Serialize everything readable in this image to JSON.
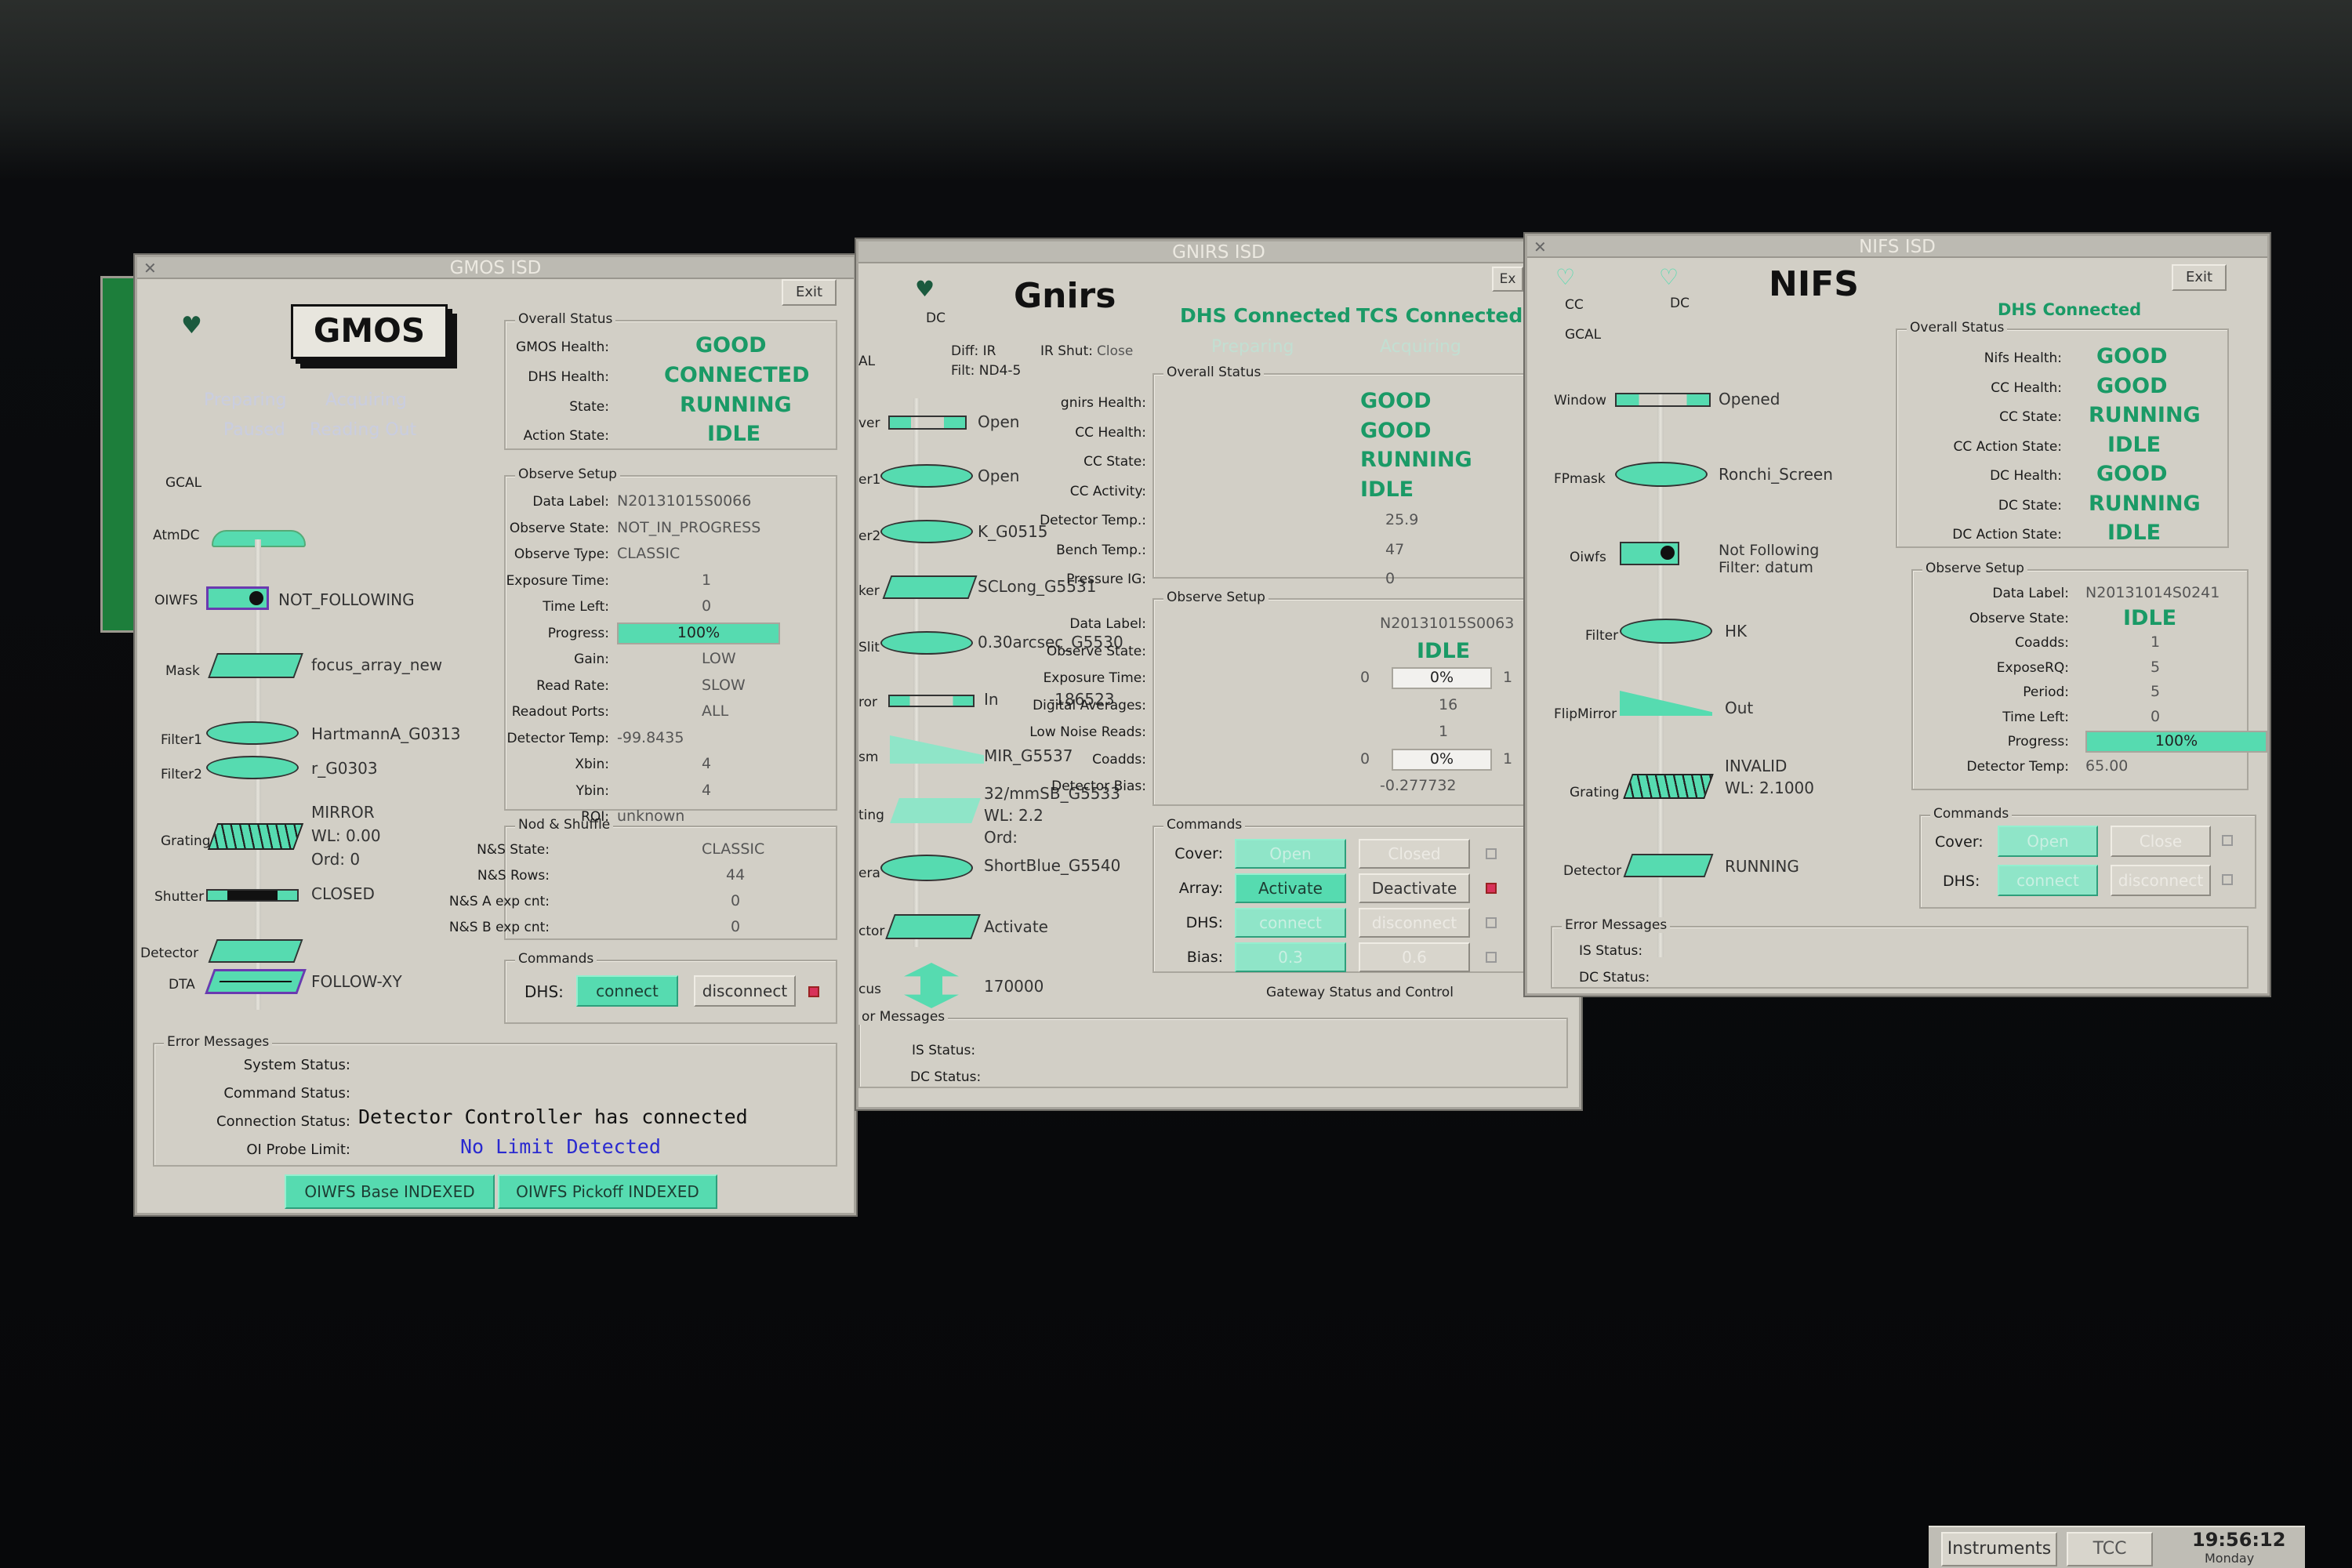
{
  "colors": {
    "accent": "#56dbb0",
    "status_good": "#1a9a66",
    "link_blue": "#2a2ad0"
  },
  "gmos": {
    "title": "GMOS ISD",
    "logo": "GMOS",
    "exit": "Exit",
    "states": [
      "Preparing",
      "Acquiring",
      "Paused",
      "Reading Out"
    ],
    "overall": {
      "title": "Overall Status",
      "rows": [
        {
          "label": "GMOS Health:",
          "value": "GOOD"
        },
        {
          "label": "DHS Health:",
          "value": "CONNECTED"
        },
        {
          "label": "State:",
          "value": "RUNNING"
        },
        {
          "label": "Action State:",
          "value": "IDLE"
        }
      ]
    },
    "setup": {
      "title": "Observe Setup",
      "rows": [
        {
          "label": "Data Label:",
          "value": "N20131015S0066"
        },
        {
          "label": "Observe State:",
          "value": "NOT_IN_PROGRESS"
        },
        {
          "label": "Observe Type:",
          "value": "CLASSIC"
        },
        {
          "label": "Exposure Time:",
          "value": "1"
        },
        {
          "label": "Time Left:",
          "value": "0"
        },
        {
          "label": "Progress:",
          "value": ""
        },
        {
          "label": "Gain:",
          "value": "LOW"
        },
        {
          "label": "Read Rate:",
          "value": "SLOW"
        },
        {
          "label": "Readout Ports:",
          "value": "ALL"
        },
        {
          "label": "Detector Temp:",
          "value": "-99.8435"
        },
        {
          "label": "Xbin:",
          "value": "4"
        },
        {
          "label": "Ybin:",
          "value": "4"
        },
        {
          "label": "ROI:",
          "value": "unknown"
        }
      ],
      "progress": "100%",
      "progress_fraction": 1.0
    },
    "nod": {
      "title": "Nod & Shuffle",
      "rows": [
        {
          "label": "N&S State:",
          "value": "CLASSIC"
        },
        {
          "label": "N&S Rows:",
          "value": "44"
        },
        {
          "label": "N&S A exp cnt:",
          "value": "0"
        },
        {
          "label": "N&S B exp cnt:",
          "value": "0"
        }
      ]
    },
    "commands": {
      "title": "Commands",
      "dhs": "DHS:",
      "connect": "connect",
      "disconnect": "disconnect"
    },
    "components": [
      {
        "label": "GCAL",
        "value": ""
      },
      {
        "label": "AtmDC",
        "value": ""
      },
      {
        "label": "OIWFS",
        "value": "NOT_FOLLOWING"
      },
      {
        "label": "Mask",
        "value": "focus_array_new"
      },
      {
        "label": "Filter1",
        "value": "HartmannA_G0313"
      },
      {
        "label": "Filter2",
        "value": "r_G0303"
      },
      {
        "label": "Grating",
        "value": "MIRROR"
      },
      {
        "label": "",
        "value": "WL: 0.00"
      },
      {
        "label": "",
        "value": "Ord: 0"
      },
      {
        "label": "Shutter",
        "value": "CLOSED"
      },
      {
        "label": "Detector",
        "value": ""
      },
      {
        "label": "DTA",
        "value": "FOLLOW-XY"
      }
    ],
    "errors": {
      "title": "Error Messages",
      "system": "System Status:",
      "command": "Command Status:",
      "connection": "Connection Status:",
      "connection_msg": "Detector Controller has connected",
      "oi": "OI Probe Limit:",
      "oi_msg": "No Limit Detected"
    },
    "bottom": [
      "OIWFS Base INDEXED",
      "OIWFS Pickoff INDEXED"
    ]
  },
  "gnirs": {
    "title": "GNIRS ISD",
    "logo": "Gnirs",
    "exit": "Ex",
    "dc": "DC",
    "dhs_connected": "DHS Connected",
    "tcs_connected": "TCS Connected",
    "states": [
      "Preparing",
      "Acquiring"
    ],
    "diff": "Diff: IR",
    "filt": "Filt: ND4-5",
    "irshut": "IR Shut:",
    "irshut_val": "Close",
    "overall": {
      "title": "Overall Status",
      "rows": [
        {
          "label": "gnirs Health:",
          "value": "GOOD"
        },
        {
          "label": "CC Health:",
          "value": "GOOD"
        },
        {
          "label": "CC State:",
          "value": "RUNNING"
        },
        {
          "label": "CC Activity:",
          "value": "IDLE"
        },
        {
          "label": "Detector Temp.:",
          "value": "25.9"
        },
        {
          "label": "Bench Temp.:",
          "value": "47"
        },
        {
          "label": "Pressure IG:",
          "value": "0"
        }
      ]
    },
    "setup": {
      "title": "Observe Setup",
      "rows": [
        {
          "label": "Data Label:",
          "value": "N20131015S0063"
        },
        {
          "label": "Observe State:",
          "value": "IDLE"
        },
        {
          "label": "Exposure Time:",
          "value": ""
        },
        {
          "label": "Digital Averages:",
          "value": "16"
        },
        {
          "label": "Low Noise Reads:",
          "value": "1"
        },
        {
          "label": "Coadds:",
          "value": ""
        },
        {
          "label": "Detector Bias:",
          "value": "-0.277732"
        }
      ],
      "exp_min": "0",
      "exp_max": "1",
      "exp_pct": "0%",
      "coadd_min": "0",
      "coadd_max": "1",
      "coadd_pct": "0%"
    },
    "commands": {
      "title": "Commands",
      "rows": [
        {
          "label": "Cover:",
          "on": "Open",
          "off": "Closed"
        },
        {
          "label": "Array:",
          "on": "Activate",
          "off": "Deactivate"
        },
        {
          "label": "DHS:",
          "on": "connect",
          "off": "disconnect"
        },
        {
          "label": "Bias:",
          "on": "0.3",
          "off": "0.6"
        }
      ],
      "gateway": "Gateway Status and Control"
    },
    "components": [
      {
        "label": "AL",
        "value": ""
      },
      {
        "label": "ver",
        "value": "Open"
      },
      {
        "label": "er1",
        "value": "Open"
      },
      {
        "label": "er2",
        "value": "K_G0515"
      },
      {
        "label": "ker",
        "value": "SCLong_G5531"
      },
      {
        "label": "Slit",
        "value": "0.30arcsec_G5530"
      },
      {
        "label": "ror",
        "value": "In"
      },
      {
        "label": "",
        "value": "-186523"
      },
      {
        "label": "sm",
        "value": "MIR_G5537"
      },
      {
        "label": "ting",
        "value": "32/mmSB_G5533"
      },
      {
        "label": "",
        "value": "WL: 2.2"
      },
      {
        "label": "",
        "value": "Ord:"
      },
      {
        "label": "era",
        "value": "ShortBlue_G5540"
      },
      {
        "label": "ctor",
        "value": "Activate"
      },
      {
        "label": "cus",
        "value": "170000"
      }
    ],
    "errors": {
      "title": "or Messages",
      "is": "IS Status:",
      "dc": "DC Status:"
    }
  },
  "nifs": {
    "title": "NIFS ISD",
    "logo": "NIFS",
    "exit": "Exit",
    "cc": "CC",
    "dc": "DC",
    "dhs_connected": "DHS Connected",
    "overall": {
      "title": "Overall Status",
      "rows": [
        {
          "label": "Nifs Health:",
          "value": "GOOD"
        },
        {
          "label": "CC Health:",
          "value": "GOOD"
        },
        {
          "label": "CC State:",
          "value": "RUNNING"
        },
        {
          "label": "CC Action State:",
          "value": "IDLE"
        },
        {
          "label": "DC Health:",
          "value": "GOOD"
        },
        {
          "label": "DC State:",
          "value": "RUNNING"
        },
        {
          "label": "DC Action State:",
          "value": "IDLE"
        }
      ]
    },
    "setup": {
      "title": "Observe Setup",
      "rows": [
        {
          "label": "Data Label:",
          "value": "N20131014S0241"
        },
        {
          "label": "Observe State:",
          "value": "IDLE"
        },
        {
          "label": "Coadds:",
          "value": "1"
        },
        {
          "label": "ExposeRQ:",
          "value": "5"
        },
        {
          "label": "Period:",
          "value": "5"
        },
        {
          "label": "Time Left:",
          "value": "0"
        },
        {
          "label": "Progress:",
          "value": ""
        },
        {
          "label": "Detector Temp:",
          "value": "65.00"
        }
      ],
      "progress": "100%",
      "progress_fraction": 1.0
    },
    "commands": {
      "title": "Commands",
      "cover": "Cover:",
      "open": "Open",
      "close": "Close",
      "dhs": "DHS:",
      "connect": "connect",
      "disconnect": "disconnect"
    },
    "components": [
      {
        "label": "GCAL",
        "value": ""
      },
      {
        "label": "Window",
        "value": "Opened"
      },
      {
        "label": "FPmask",
        "value": "Ronchi_Screen"
      },
      {
        "label": "Oiwfs",
        "value": "Not Following"
      },
      {
        "label": "",
        "value": "Filter: datum"
      },
      {
        "label": "Filter",
        "value": "HK"
      },
      {
        "label": "FlipMirror",
        "value": "Out"
      },
      {
        "label": "Grating",
        "value": "INVALID"
      },
      {
        "label": "",
        "value": "WL: 2.1000"
      },
      {
        "label": "Detector",
        "value": "RUNNING"
      }
    ],
    "errors": {
      "title": "Error Messages",
      "is": "IS Status:",
      "dc": "DC Status:"
    }
  },
  "taskbar": {
    "instruments": "Instruments",
    "tcc": "TCC",
    "clock": "19:56:12",
    "day": "Monday"
  }
}
